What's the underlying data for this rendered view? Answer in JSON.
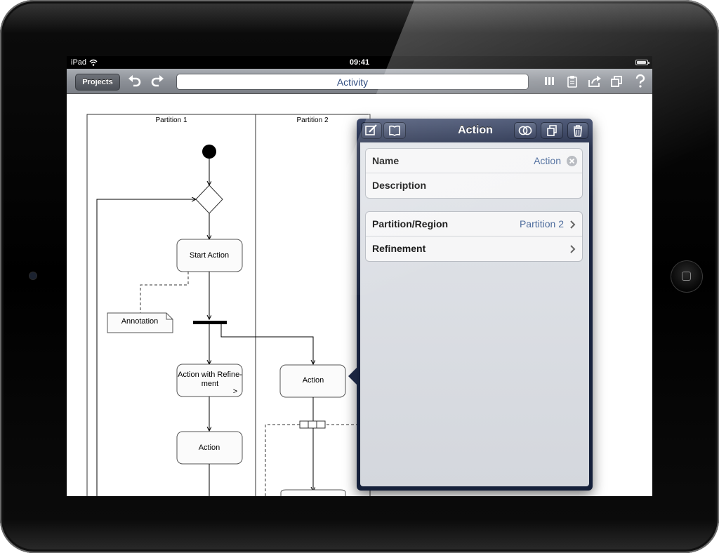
{
  "status_bar": {
    "carrier": "iPad",
    "time": "09:41",
    "battery_level": 0.9
  },
  "toolbar": {
    "projects_label": "Projects",
    "title": "Activity",
    "icons": [
      "undo-icon",
      "redo-icon",
      "library-icon",
      "clipboard-icon",
      "share-icon",
      "duplicate-icon",
      "help-icon"
    ]
  },
  "diagram": {
    "partition_1": "Partition 1",
    "partition_2": "Partition 2",
    "start_action": "Start Action",
    "annotation": "Annotation",
    "action_refinement_line1": "Action with Refine-",
    "action_refinement_line2": "ment",
    "refinement_marker": ">",
    "action_1": "Action",
    "action_2": "Action"
  },
  "inspector": {
    "title": "Action",
    "name_label": "Name",
    "name_value": "Action",
    "description_label": "Description",
    "partition_label": "Partition/Region",
    "partition_value": "Partition 2",
    "refinement_label": "Refinement",
    "icons": [
      "edit-icon",
      "book-icon",
      "overlap-icon",
      "copy-icon",
      "trash-icon"
    ]
  },
  "colors": {
    "accent": "#2f4c7f",
    "value_text": "#4c6b9c",
    "popover_bg": "#1c2642"
  }
}
